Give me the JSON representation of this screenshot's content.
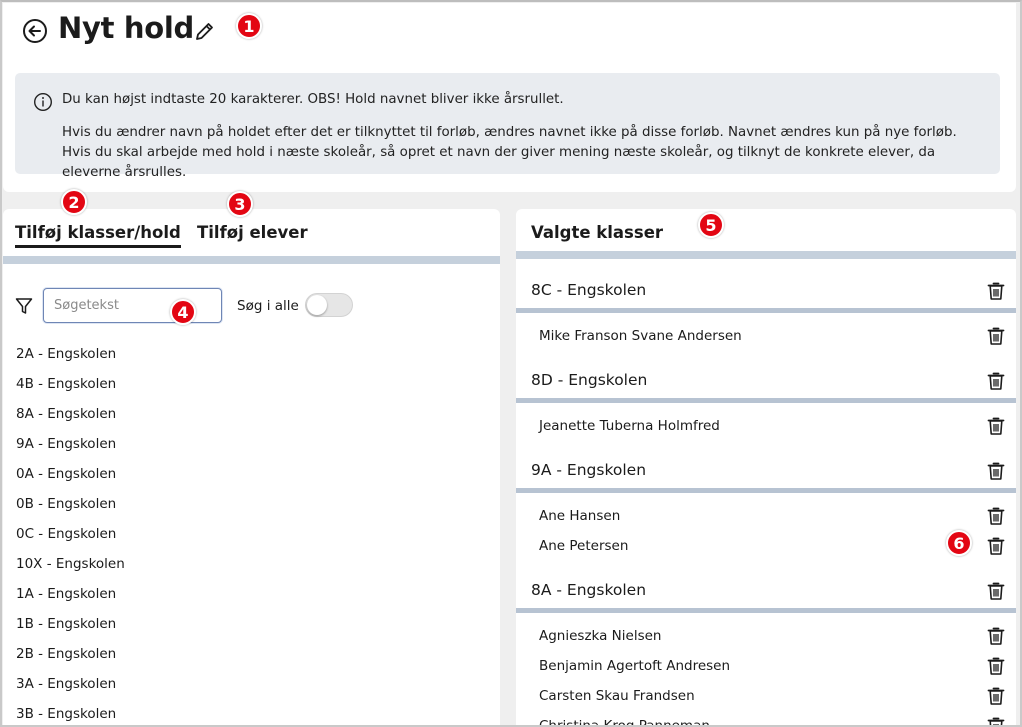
{
  "header": {
    "title": "Nyt hold",
    "info_line1": "Du kan højst indtaste 20 karakterer. OBS! Hold navnet bliver ikke årsrullet.",
    "info_line2": "Hvis du ændrer navn på holdet efter det er tilknyttet til forløb, ændres navnet ikke på disse forløb. Navnet ændres kun på nye forløb. Hvis du skal arbejde med hold i næste skoleår, så opret et navn der giver mening næste skoleår, og tilknyt de konkrete elever, da eleverne årsrulles."
  },
  "badges": [
    "1",
    "2",
    "3",
    "4",
    "5",
    "6"
  ],
  "left_panel": {
    "tabs": [
      "Tilføj klasser/hold",
      "Tilføj elever"
    ],
    "search_placeholder": "Søgetekst",
    "search_all_label": "Søg i alle",
    "search_all_enabled": false,
    "classes": [
      "2A - Engskolen",
      "4B - Engskolen",
      "8A - Engskolen",
      "9A - Engskolen",
      "0A - Engskolen",
      "0B - Engskolen",
      "0C - Engskolen",
      "10X - Engskolen",
      "1A - Engskolen",
      "1B - Engskolen",
      "2B - Engskolen",
      "3A - Engskolen",
      "3B - Engskolen"
    ]
  },
  "right_panel": {
    "title": "Valgte klasser",
    "groups": [
      {
        "name": "8C - Engskolen",
        "students": [
          "Mike Franson Svane Andersen"
        ]
      },
      {
        "name": "8D - Engskolen",
        "students": [
          "Jeanette Tuberna Holmfred"
        ]
      },
      {
        "name": "9A - Engskolen",
        "students": [
          "Ane Hansen",
          "Ane Petersen"
        ]
      },
      {
        "name": "8A - Engskolen",
        "students": [
          "Agnieszka Nielsen",
          "Benjamin Agertoft Andresen",
          "Carsten Skau Frandsen",
          "Christina Krog Panneman"
        ]
      }
    ]
  },
  "colors": {
    "badge": "#e30613",
    "separator": "#c5d0dc",
    "group_line": "#b7c3d2",
    "info_bg": "#e9ecf0",
    "page_bg": "#efefef"
  },
  "icons": [
    "back-arrow-icon",
    "pencil-icon",
    "info-icon",
    "filter-icon",
    "trash-icon"
  ]
}
